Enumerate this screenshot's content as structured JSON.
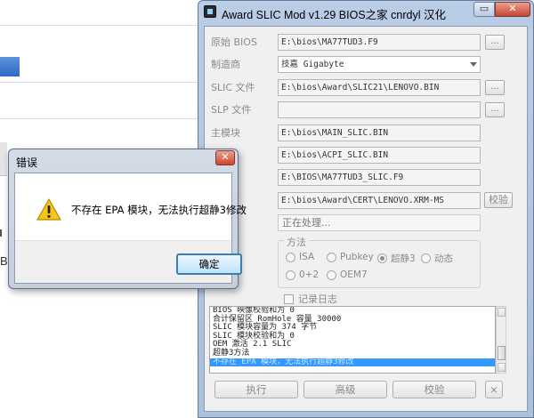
{
  "main_window": {
    "title": "Award SLIC Mod v1.29  BIOS之家 cnrdyl 汉化",
    "minimize_glyph": "▭",
    "close_glyph": "✕",
    "rows": [
      {
        "label": "原始 BIOS",
        "value": "E:\\bios\\MA77TUD3.F9"
      },
      {
        "label": "制造商",
        "value": "技嘉 Gigabyte"
      },
      {
        "label": "SLIC 文件",
        "value": "E:\\bios\\Award\\SLIC21\\LENOVO.BIN"
      },
      {
        "label": "SLP 文件",
        "value": ""
      },
      {
        "label": "主模块",
        "value": "E:\\bios\\MAIN_SLIC.BIN"
      },
      {
        "label": "",
        "value": "E:\\bios\\ACPI_SLIC.BIN"
      },
      {
        "label": "",
        "value": "E:\\BIOS\\MA77TUD3_SLIC.F9"
      },
      {
        "label": "",
        "value": "E:\\bios\\Award\\CERT\\LENOVO.XRM-MS"
      }
    ],
    "browse_label": "...",
    "verify_label": "校验",
    "processing_text": "正在处理...",
    "method_group": {
      "title": "方法",
      "options": [
        "ISA",
        "Pubkey",
        "超静3",
        "动态",
        "0+2",
        "OEM7"
      ],
      "selected": "超静3"
    },
    "log_checkbox_label": "记录日志",
    "log_lines": [
      "BIOS 映像校验和为 0",
      "合计保留区 RomHole 容量 30000",
      "SLIC 模块容量为 374 字节",
      "SLIC 模块校验和为 0",
      "OEM 激活 2.1 SLIC",
      "超静3方法",
      "不存在 EPA 模块，无法执行超静3修改"
    ],
    "selected_log_index": 6,
    "buttons": {
      "execute": "执行",
      "advanced": "高级",
      "verify": "校验",
      "close": "×"
    }
  },
  "error_dialog": {
    "title": "错误",
    "close_glyph": "✕",
    "message": "不存在 EPA 模块，无法执行超静3修改",
    "ok_label": "确定"
  },
  "background": {
    "fragment_text": "B"
  },
  "colors": {
    "selection": "#3399ff",
    "title_gradient_top": "#b9cde6",
    "close_button": "#c9452e",
    "warning_yellow": "#f5c518"
  }
}
